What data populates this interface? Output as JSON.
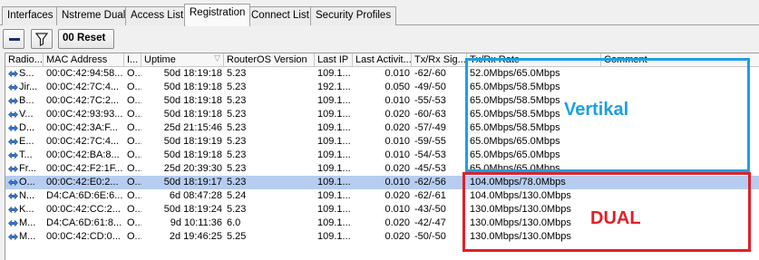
{
  "tabs": [
    {
      "label": "Interfaces",
      "active": false
    },
    {
      "label": "Nstreme Dual",
      "active": false
    },
    {
      "label": "Access List",
      "active": false
    },
    {
      "label": "Registration",
      "active": true
    },
    {
      "label": "Connect List",
      "active": false
    },
    {
      "label": "Security Profiles",
      "active": false
    }
  ],
  "toolbar": {
    "remove_icon": "minus-icon",
    "filter_icon": "filter-icon",
    "reset_label": "00 Reset"
  },
  "columns": [
    "Radio...",
    "MAC Address",
    "I...",
    "Uptime",
    "RouterOS Version",
    "Last IP",
    "Last Activit...",
    "Tx/Rx Sig...",
    "Tx/Rx Rate",
    "Comment"
  ],
  "rows": [
    {
      "radio": "S...",
      "mac": "00:0C:42:94:58...",
      "i": "O...",
      "uptime": "50d 18:19:18",
      "ros": "5.23",
      "ip": "109.1...",
      "act": "0.010",
      "sig": "-62/-60",
      "rate": "52.0Mbps/65.0Mbps"
    },
    {
      "radio": "Jir...",
      "mac": "00:0C:42:7C:4...",
      "i": "O...",
      "uptime": "50d 18:19:18",
      "ros": "5.23",
      "ip": "192.1...",
      "act": "0.050",
      "sig": "-49/-50",
      "rate": "65.0Mbps/58.5Mbps"
    },
    {
      "radio": "B...",
      "mac": "00:0C:42:7C:2...",
      "i": "O...",
      "uptime": "50d 18:19:18",
      "ros": "5.23",
      "ip": "109.1...",
      "act": "0.010",
      "sig": "-55/-53",
      "rate": "65.0Mbps/58.5Mbps"
    },
    {
      "radio": "V...",
      "mac": "00:0C:42:93:93...",
      "i": "O...",
      "uptime": "50d 18:19:18",
      "ros": "5.23",
      "ip": "109.1...",
      "act": "0.020",
      "sig": "-60/-63",
      "rate": "65.0Mbps/58.5Mbps"
    },
    {
      "radio": "D...",
      "mac": "00:0C:42:3A:F...",
      "i": "O...",
      "uptime": "25d 21:15:46",
      "ros": "5.23",
      "ip": "109.1...",
      "act": "0.020",
      "sig": "-57/-49",
      "rate": "65.0Mbps/58.5Mbps"
    },
    {
      "radio": "E...",
      "mac": "00:0C:42:7C:4...",
      "i": "O...",
      "uptime": "50d 18:19:19",
      "ros": "5.23",
      "ip": "109.1...",
      "act": "0.010",
      "sig": "-59/-55",
      "rate": "65.0Mbps/65.0Mbps"
    },
    {
      "radio": "T...",
      "mac": "00:0C:42:BA:8...",
      "i": "O...",
      "uptime": "50d 18:19:18",
      "ros": "5.23",
      "ip": "109.1...",
      "act": "0.010",
      "sig": "-54/-53",
      "rate": "65.0Mbps/65.0Mbps"
    },
    {
      "radio": "Fr...",
      "mac": "00:0C:42:F2:1F...",
      "i": "O...",
      "uptime": "25d 20:39:30",
      "ros": "5.23",
      "ip": "109.1...",
      "act": "0.020",
      "sig": "-45/-53",
      "rate": "65.0Mbps/65.0Mbps"
    },
    {
      "radio": "O...",
      "mac": "00:0C:42:E0:2...",
      "i": "O...",
      "uptime": "50d 18:19:17",
      "ros": "5.23",
      "ip": "109.1...",
      "act": "0.010",
      "sig": "-62/-56",
      "rate": "104.0Mbps/78.0Mbps",
      "selected": true
    },
    {
      "radio": "N...",
      "mac": "D4:CA:6D:6E:6...",
      "i": "O...",
      "uptime": "6d 08:47:28",
      "ros": "5.24",
      "ip": "109.1...",
      "act": "0.020",
      "sig": "-62/-61",
      "rate": "104.0Mbps/130.0Mbps"
    },
    {
      "radio": "K...",
      "mac": "00:0C:42:CC:2...",
      "i": "O...",
      "uptime": "50d 18:19:24",
      "ros": "5.23",
      "ip": "109.1...",
      "act": "0.010",
      "sig": "-43/-50",
      "rate": "130.0Mbps/130.0Mbps"
    },
    {
      "radio": "M...",
      "mac": "D4:CA:6D:61:8...",
      "i": "O...",
      "uptime": "9d 10:11:36",
      "ros": "6.0",
      "ip": "109.1...",
      "act": "0.020",
      "sig": "-42/-47",
      "rate": "130.0Mbps/130.0Mbps"
    },
    {
      "radio": "M...",
      "mac": "00:0C:42:CD:0...",
      "i": "O...",
      "uptime": "2d 19:46:25",
      "ros": "5.25",
      "ip": "109.1...",
      "act": "0.020",
      "sig": "-50/-50",
      "rate": "130.0Mbps/130.0Mbps"
    }
  ],
  "annotations": {
    "vertikal": {
      "label": "Vertikal",
      "color": "#1ba1e2"
    },
    "dual": {
      "label": "DUAL",
      "color": "#e0202a"
    }
  },
  "icons": {
    "row_icon": "radio-link-icon",
    "sort_icon": "sort-down-icon"
  },
  "colors": {
    "selected_row": "#b7cdf0"
  }
}
